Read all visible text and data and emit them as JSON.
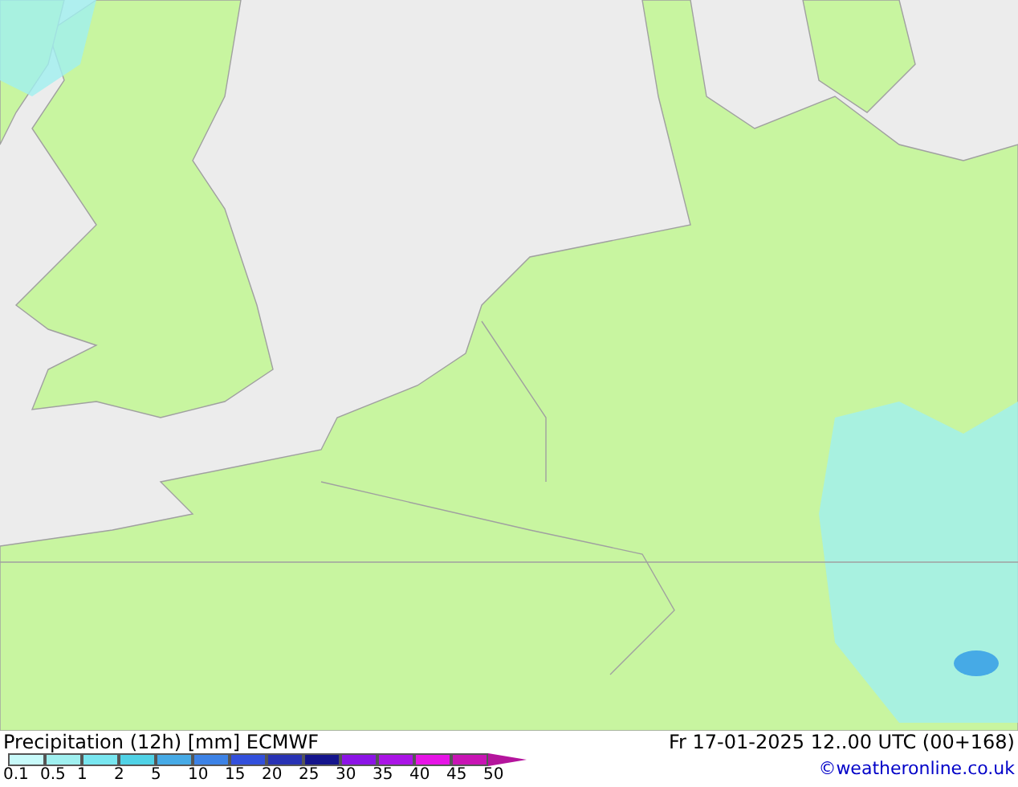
{
  "title": "Precipitation (12h) [mm] ECMWF",
  "valid_time": "Fr 17-01-2025 12..00 UTC (00+168)",
  "credit": "©weatheronline.co.uk",
  "legend": {
    "segments": [
      {
        "color": "#c8fafa"
      },
      {
        "color": "#a0f0f0"
      },
      {
        "color": "#78e6f0"
      },
      {
        "color": "#50d2e6"
      },
      {
        "color": "#46aae6"
      },
      {
        "color": "#3c82e6"
      },
      {
        "color": "#3250dc"
      },
      {
        "color": "#2832b4"
      },
      {
        "color": "#14148c"
      },
      {
        "color": "#8c14e6"
      },
      {
        "color": "#aa14e6"
      },
      {
        "color": "#e614e6"
      },
      {
        "color": "#c814b4"
      }
    ],
    "labels": [
      "0.1",
      "0.5",
      "1",
      "2",
      "5",
      "10",
      "15",
      "20",
      "25",
      "30",
      "35",
      "40",
      "45",
      "50"
    ]
  }
}
